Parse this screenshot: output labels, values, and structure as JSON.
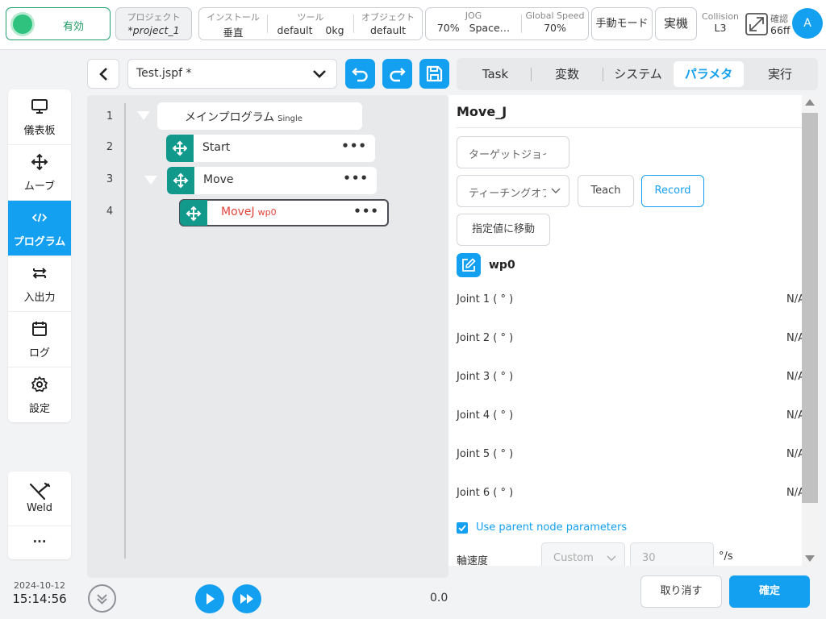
{
  "topbar": {
    "enable_label": "有効",
    "project_key": "プロジェクト",
    "project_value": "*project_1",
    "install_key": "インストール",
    "install_value": "垂直",
    "tool_key": "ツール",
    "tool_value": "default",
    "tool_payload": "0kg",
    "object_key": "オブジェクト",
    "object_value": "default",
    "jog_key": "JOG",
    "jog_value": "70%",
    "jog_space": "Space…",
    "global_speed_key": "Global Speed",
    "global_speed_value": "70%",
    "manual_mode": "手動モード",
    "real_machine": "実機",
    "collision_key": "Collision",
    "collision_value": "L3",
    "confirm_key": "確認",
    "confirm_value": "66ff",
    "avatar_letter": "A",
    "accent_color": "#14a0f0",
    "enable_color": "#2fc27f"
  },
  "sidebar": {
    "items": [
      {
        "label": "儀表板",
        "icon": "monitor-icon"
      },
      {
        "label": "ムーブ",
        "icon": "move-arrows-icon"
      },
      {
        "label": "プログラム",
        "icon": "code-icon"
      },
      {
        "label": "入出力",
        "icon": "swap-arrows-icon"
      },
      {
        "label": "ログ",
        "icon": "calendar-icon"
      },
      {
        "label": "設定",
        "icon": "gear-icon"
      }
    ],
    "active": "プログラム",
    "weld_label": "Weld",
    "more_label": "···",
    "date": "2024-10-12",
    "time": "15:14:56"
  },
  "program": {
    "file_name": "Test.jspf *",
    "lines": [
      "1",
      "2",
      "3",
      "4"
    ],
    "main_label": "メインプログラム",
    "main_sub": "Single",
    "start_label": "Start",
    "move_label": "Move",
    "movej_label": "MoveJ",
    "movej_sub": "wp0",
    "dots": "•••",
    "speed_value": "0.0",
    "handle_color": "#119a8c"
  },
  "tabs": [
    "Task",
    "変数",
    "システム",
    "パラメタ",
    "実行"
  ],
  "active_tab": "パラメタ",
  "params": {
    "title": "Move_J",
    "target_select": "ターゲットジョイント",
    "teaching_select": "ティーチングオプション",
    "teach_label": "Teach",
    "record_label": "Record",
    "move_to_label": "指定値に移動",
    "waypoint_name": "wp0",
    "joints": [
      {
        "label": "Joint 1 ( ° )",
        "value": "N/A"
      },
      {
        "label": "Joint 2 ( ° )",
        "value": "N/A"
      },
      {
        "label": "Joint 3 ( ° )",
        "value": "N/A"
      },
      {
        "label": "Joint 4 ( ° )",
        "value": "N/A"
      },
      {
        "label": "Joint 5 ( ° )",
        "value": "N/A"
      },
      {
        "label": "Joint 6 ( ° )",
        "value": "N/A"
      }
    ],
    "use_parent_label": "Use parent node parameters",
    "use_parent_checked": true,
    "axis_speed_label": "軸速度",
    "axis_speed_mode": "Custom",
    "axis_speed_value": "30",
    "axis_speed_unit": "°/s"
  },
  "footer": {
    "cancel_label": "取り消す",
    "ok_label": "確定"
  }
}
